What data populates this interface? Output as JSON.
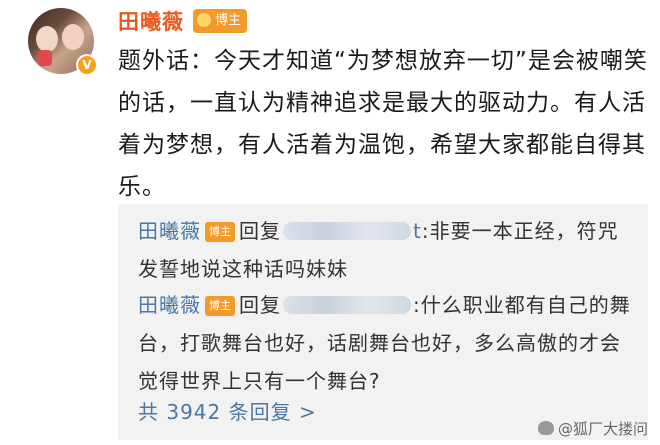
{
  "post": {
    "username": "田曦薇",
    "badge": "博主",
    "verified_mark": "V",
    "text": "题外话：今天才知道“为梦想放弃一切”是会被嘲笑的话，一直认为精神追求是最大的驱动力。有人活着为梦想，有人活着为温饱，希望大家都能自得其乐。"
  },
  "replies": [
    {
      "name": "田曦薇",
      "tag": "博主",
      "reply_word": "回复",
      "partial_handle": "t",
      "text": ":非要一本正经，符咒发誓地说这种话吗妹妹"
    },
    {
      "name": "田曦薇",
      "tag": "博主",
      "reply_word": "回复",
      "partial_handle": "",
      "text": ":什么职业都有自己的舞台，打歌舞台也好，话剧舞台也好，多么高傲的才会觉得世界上只有一个舞台?"
    }
  ],
  "total_replies": "共 3942 条回复 >",
  "watermark": "@狐厂大搂问",
  "colors": {
    "username": "#e85c1f",
    "badge": "#f39a2c",
    "link": "#4a77a5",
    "reply_bg": "#f2f2f2"
  }
}
